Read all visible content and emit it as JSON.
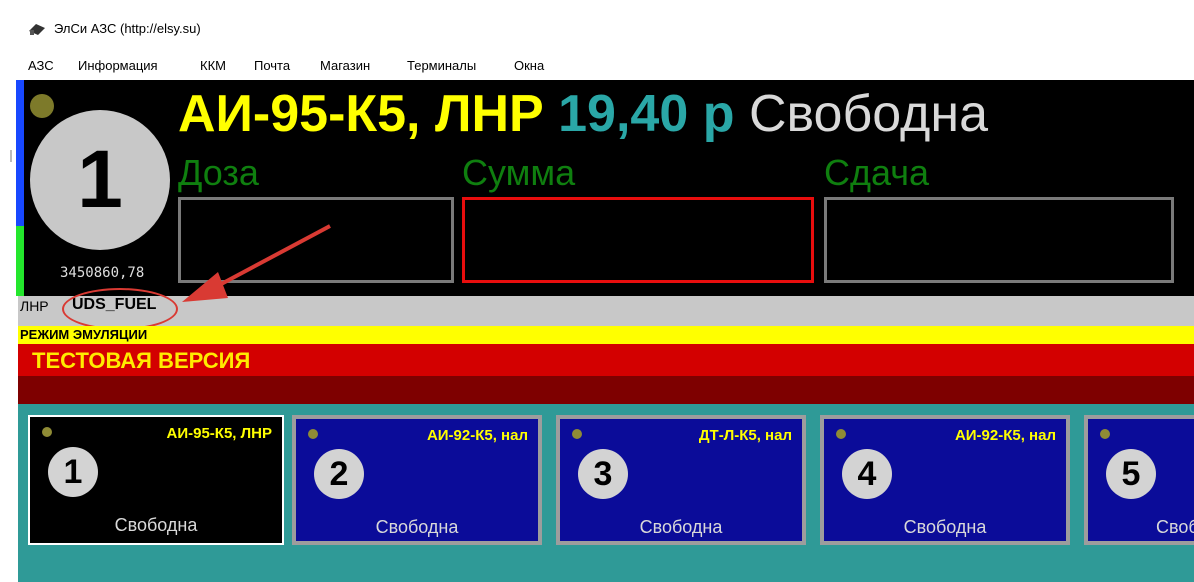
{
  "window": {
    "title": "ЭлСи АЗС  (http://elsy.su)",
    "icon": "app-icon"
  },
  "menu": [
    {
      "label": "АЗС"
    },
    {
      "label": "Информация"
    },
    {
      "label": "ККМ"
    },
    {
      "label": "Почта"
    },
    {
      "label": "Магазин"
    },
    {
      "label": "Терминалы"
    },
    {
      "label": "Окна"
    }
  ],
  "pump_header": {
    "number": "1",
    "counter": "3450860,78",
    "fuel": "АИ-95-К5, ЛНР",
    "price": "19,40 р",
    "status": "Свободна"
  },
  "fields": [
    {
      "label": "Доза",
      "value": ""
    },
    {
      "label": "Сумма",
      "value": ""
    },
    {
      "label": "Сдача",
      "value": ""
    }
  ],
  "info": {
    "region": "ЛНР",
    "loyalty": "UDS_FUEL"
  },
  "emulation_text": "РЕЖИМ ЭМУЛЯЦИИ",
  "test_version_text": "ТЕСТОВАЯ ВЕРСИЯ",
  "pumps": [
    {
      "number": "1",
      "fuel": "АИ-95-К5, ЛНР",
      "status": "Свободна"
    },
    {
      "number": "2",
      "fuel": "АИ-92-К5, нал",
      "status": "Свободна"
    },
    {
      "number": "3",
      "fuel": "ДТ-Л-К5, нал",
      "status": "Свободна"
    },
    {
      "number": "4",
      "fuel": "АИ-92-К5, нал",
      "status": "Свободна"
    },
    {
      "number": "5",
      "fuel": "",
      "status": "Свободна"
    }
  ],
  "colors": {
    "fuel_name": "#ffff00",
    "price": "#2aa7a7",
    "field_label": "#0f7f0f",
    "active_border": "#e80d0d",
    "pump_card": "#0b0c99",
    "annotation": "#d93a33"
  }
}
